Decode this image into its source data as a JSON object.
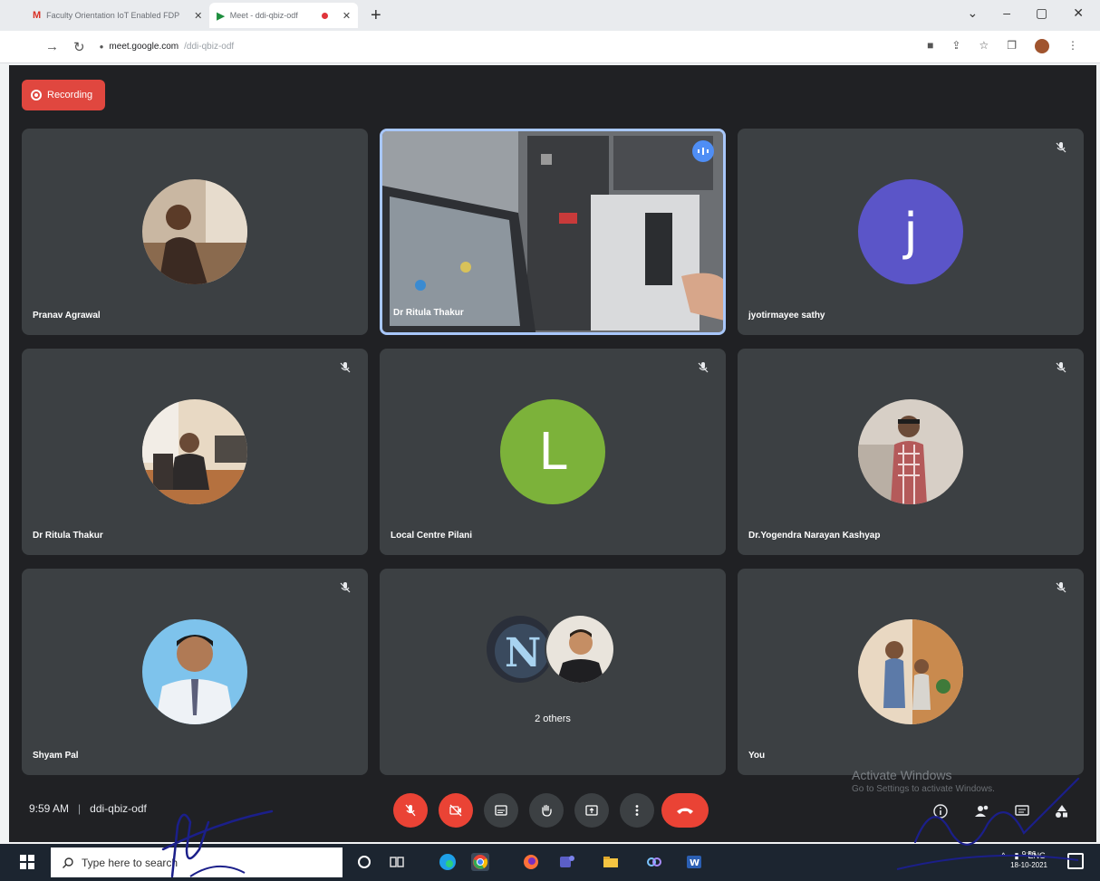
{
  "browser": {
    "tabs": [
      {
        "label": "Faculty Orientation IoT Enabled FDP",
        "favicon": "gmail-icon"
      },
      {
        "label": "Meet - ddi-qbiz-odf",
        "favicon": "meet-icon"
      }
    ],
    "url_host": "meet.google.com",
    "url_path": "/ddi-qbiz-odf"
  },
  "meet": {
    "recording_label": "Recording",
    "meeting_time": "9:59 AM",
    "meeting_code": "ddi-qbiz-odf",
    "participants": [
      {
        "name": "Pranav Agrawal",
        "avatar": "photo",
        "muted": false
      },
      {
        "name": "Dr Ritula Thakur",
        "avatar": "video",
        "muted": false,
        "active_speaker": true
      },
      {
        "name": "jyotirmayee sathy",
        "avatar": "letter",
        "letter": "j",
        "color": "#5b55c8",
        "muted": true
      },
      {
        "name": "Dr Ritula Thakur",
        "avatar": "photo",
        "muted": true
      },
      {
        "name": "Local Centre Pilani",
        "avatar": "letter",
        "letter": "L",
        "color": "#7cb23a",
        "muted": true
      },
      {
        "name": "Dr.Yogendra Narayan Kashyap",
        "avatar": "photo",
        "muted": true
      },
      {
        "name": "Shyam Pal",
        "avatar": "photo",
        "muted": true
      },
      {
        "name": "2 others",
        "avatar": "group",
        "muted": false
      },
      {
        "name": "You",
        "avatar": "photo",
        "muted": true
      }
    ]
  },
  "windows_watermark": {
    "line1": "Activate Windows",
    "line2": "Go to Settings to activate Windows."
  },
  "taskbar": {
    "search_placeholder": "Type here to search",
    "time": "9:56",
    "date": "18-10-2021",
    "lang": "ENG"
  }
}
